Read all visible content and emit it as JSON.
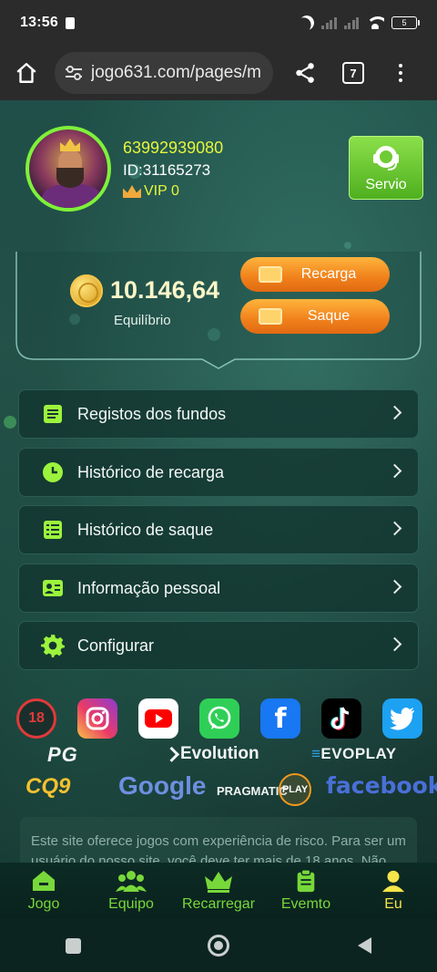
{
  "status_bar": {
    "time": "13:56",
    "battery": "5"
  },
  "browser": {
    "url": "jogo631.com/pages/m",
    "tab_count": "7"
  },
  "profile": {
    "phone": "63992939080",
    "id": "ID:31165273",
    "vip": "VIP 0",
    "service_label": "Servio"
  },
  "balance": {
    "amount": "10.146,64",
    "label": "Equilíbrio",
    "recharge_label": "Recarga",
    "withdraw_label": "Saque"
  },
  "menu": [
    {
      "label": "Registos dos fundos",
      "icon": "document-icon"
    },
    {
      "label": "Histórico de recarga",
      "icon": "clock-icon"
    },
    {
      "label": "Histórico de saque",
      "icon": "list-icon"
    },
    {
      "label": "Informação pessoal",
      "icon": "id-card-icon"
    },
    {
      "label": "Configurar",
      "icon": "gear-icon"
    }
  ],
  "social": [
    "18-plus-icon",
    "instagram-icon",
    "youtube-icon",
    "whatsapp-icon",
    "facebook-icon",
    "tiktok-icon",
    "twitter-icon"
  ],
  "brands": {
    "pg": "PG",
    "evolution": "Evolution",
    "evoplay": "EVOPLAY",
    "cq9": "CQ9",
    "google": "Google",
    "pragmatic": "PRAGMATIC",
    "pragmatic_play": "PLAY",
    "facebook": "facebook"
  },
  "disclaimer": "Este site oferece jogos com experiência de risco. Para ser um usuário do nosso site, você deve ter mais de 18 anos. Não",
  "tabs": [
    {
      "label": "Jogo",
      "icon": "home-icon"
    },
    {
      "label": "Equipo",
      "icon": "team-icon"
    },
    {
      "label": "Recarregar",
      "icon": "crown-icon"
    },
    {
      "label": "Evemto",
      "icon": "clipboard-icon"
    },
    {
      "label": "Eu",
      "icon": "user-icon",
      "active": true
    }
  ],
  "colors": {
    "accent_green": "#78d83a",
    "accent_yellow": "#e6f53a",
    "orange_button": "#f0801b"
  }
}
